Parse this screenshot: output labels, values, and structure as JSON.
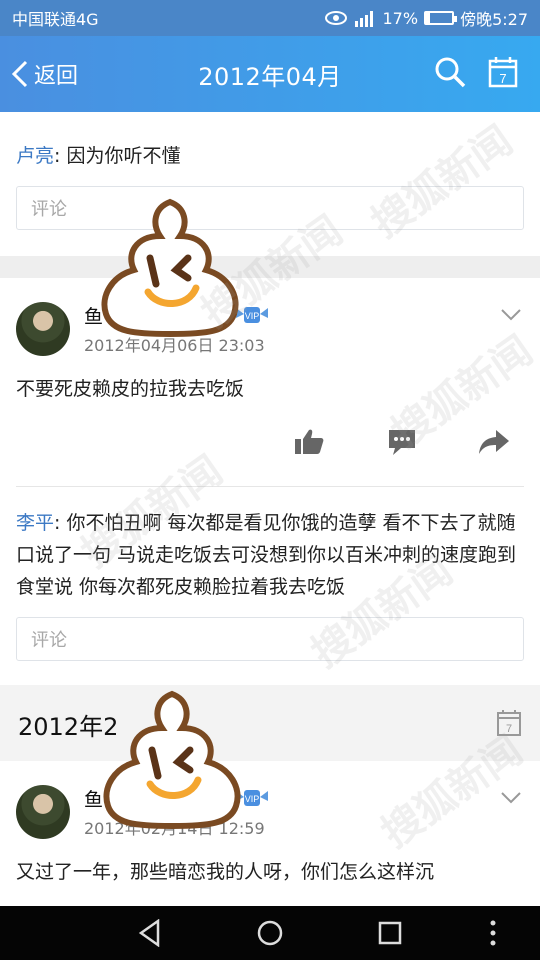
{
  "status_bar": {
    "carrier": "中国联通4G",
    "battery": "17%",
    "battery_level": 0.17,
    "time": "傍晚5:27"
  },
  "topbar": {
    "back_label": "返回",
    "title": "2012年04月"
  },
  "first_block": {
    "user": "卢亮",
    "sep": ": ",
    "text": "因为你听不懂",
    "comment_placeholder": "评论"
  },
  "post1": {
    "name": "鱼",
    "date": "2012年04月06日 23:03",
    "text": "不要死皮赖皮的拉我去吃饭",
    "comment": {
      "user": "李平",
      "sep": ": ",
      "text": "你不怕丑啊 每次都是看见你饿的造孽 看不下去了就随口说了一句 马说走吃饭去可没想到你以百米冲刺的速度跑到食堂说 你每次都死皮赖脸拉着我去吃饭"
    },
    "comment_placeholder": "评论"
  },
  "section2": {
    "title": "2012年2"
  },
  "post2": {
    "name": "鱼",
    "date": "2012年02月14日 12:59",
    "text": "又过了一年，那些暗恋我的人呀，你们怎么这样沉"
  },
  "watermark": "搜狐新闻",
  "colors": {
    "topbar_start": "#4a8fe0",
    "topbar_end": "#37a9f0",
    "username": "#3c79c4",
    "icon_gray": "#666666"
  }
}
